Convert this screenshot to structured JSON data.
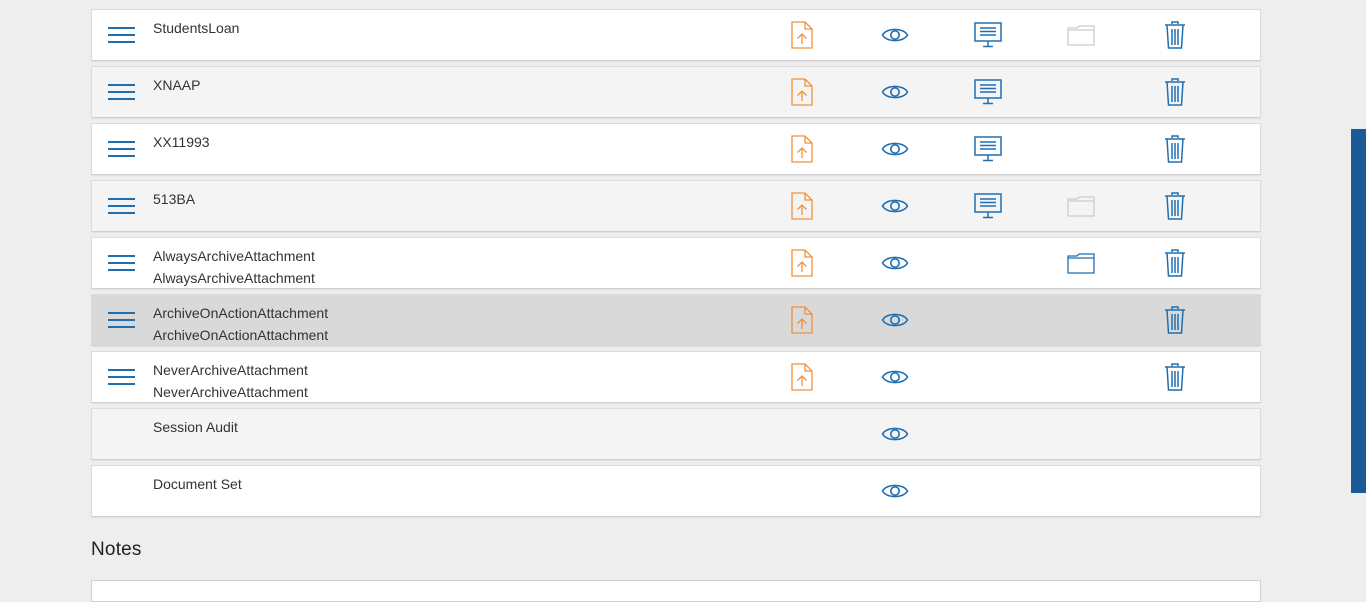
{
  "colors": {
    "upload": "#f0913a",
    "icon": "#1f6fb0",
    "folder_dim": "#cccccc",
    "scrollbar": "#1c5a97"
  },
  "icon_names": {
    "drag": "drag-handle-icon",
    "upload": "upload-file-icon",
    "view": "eye-icon",
    "present": "presentation-icon",
    "folder": "folder-icon",
    "delete": "trash-icon"
  },
  "rows": [
    {
      "style": "white",
      "lines": [
        "StudentsLoan"
      ],
      "drag": true,
      "upload": true,
      "view": true,
      "present": true,
      "folder": "dim",
      "delete": true
    },
    {
      "style": "grey",
      "lines": [
        "XNAAP"
      ],
      "drag": true,
      "upload": true,
      "view": true,
      "present": true,
      "folder": "none",
      "delete": true
    },
    {
      "style": "white",
      "lines": [
        "XX11993"
      ],
      "drag": true,
      "upload": true,
      "view": true,
      "present": true,
      "folder": "none",
      "delete": true
    },
    {
      "style": "grey",
      "lines": [
        "513BA"
      ],
      "drag": true,
      "upload": true,
      "view": true,
      "present": true,
      "folder": "dim",
      "delete": true
    },
    {
      "style": "white",
      "lines": [
        "AlwaysArchiveAttachment",
        "AlwaysArchiveAttachment"
      ],
      "drag": true,
      "upload": true,
      "view": true,
      "present": false,
      "folder": "active",
      "delete": true
    },
    {
      "style": "sel",
      "lines": [
        "ArchiveOnActionAttachment",
        "ArchiveOnActionAttachment"
      ],
      "drag": true,
      "upload": true,
      "view": true,
      "present": false,
      "folder": "none",
      "delete": true
    },
    {
      "style": "white",
      "lines": [
        "NeverArchiveAttachment",
        "NeverArchiveAttachment"
      ],
      "drag": true,
      "upload": true,
      "view": true,
      "present": false,
      "folder": "none",
      "delete": true
    },
    {
      "style": "grey",
      "lines": [
        "Session Audit"
      ],
      "drag": false,
      "upload": false,
      "view": true,
      "present": false,
      "folder": "none",
      "delete": false
    },
    {
      "style": "white",
      "lines": [
        "Document Set"
      ],
      "drag": false,
      "upload": false,
      "view": true,
      "present": false,
      "folder": "none",
      "delete": false
    }
  ],
  "notes": {
    "heading": "Notes"
  }
}
